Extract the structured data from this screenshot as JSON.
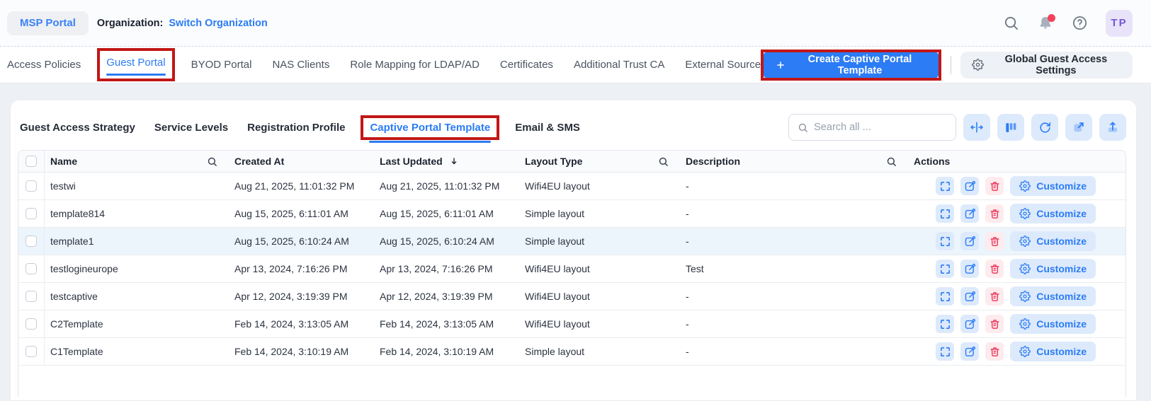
{
  "header": {
    "msp_portal_label": "MSP Portal",
    "organization_label": "Organization:",
    "organization_name": "Switch Organization",
    "avatar_initials": "TP"
  },
  "tabs": {
    "items": [
      "Access Policies",
      "Guest Portal",
      "BYOD Portal",
      "NAS Clients",
      "Role Mapping for LDAP/AD",
      "Certificates",
      "Additional Trust CA",
      "External Source"
    ],
    "active": "Guest Portal"
  },
  "top_actions": {
    "create_button": "Create Captive Portal Template",
    "global_settings_button": "Global Guest Access Settings"
  },
  "subtabs": {
    "items": [
      "Guest Access Strategy",
      "Service Levels",
      "Registration Profile",
      "Captive Portal Template",
      "Email & SMS"
    ],
    "active": "Captive Portal Template"
  },
  "toolbar": {
    "search_placeholder": "Search all ...",
    "icon_buttons": [
      "column-resize-icon",
      "table-columns-icon",
      "refresh-icon",
      "export-icon",
      "upload-icon"
    ]
  },
  "table": {
    "columns": {
      "name": "Name",
      "created_at": "Created At",
      "last_updated": "Last Updated",
      "layout_type": "Layout Type",
      "description": "Description",
      "actions": "Actions"
    },
    "sort": {
      "column": "Last Updated",
      "direction": "desc"
    },
    "customize_label": "Customize",
    "rows": [
      {
        "name": "testwi",
        "created_at": "Aug 21, 2025, 11:01:32 PM",
        "last_updated": "Aug 21, 2025, 11:01:32 PM",
        "layout_type": "Wifi4EU layout",
        "description": "-",
        "highlighted": false
      },
      {
        "name": "template814",
        "created_at": "Aug 15, 2025, 6:11:01 AM",
        "last_updated": "Aug 15, 2025, 6:11:01 AM",
        "layout_type": "Simple layout",
        "description": "-",
        "highlighted": false
      },
      {
        "name": "template1",
        "created_at": "Aug 15, 2025, 6:10:24 AM",
        "last_updated": "Aug 15, 2025, 6:10:24 AM",
        "layout_type": "Simple layout",
        "description": "-",
        "highlighted": true
      },
      {
        "name": "testlogineurope",
        "created_at": "Apr 13, 2024, 7:16:26 PM",
        "last_updated": "Apr 13, 2024, 7:16:26 PM",
        "layout_type": "Wifi4EU layout",
        "description": "Test",
        "highlighted": false
      },
      {
        "name": "testcaptive",
        "created_at": "Apr 12, 2024, 3:19:39 PM",
        "last_updated": "Apr 12, 2024, 3:19:39 PM",
        "layout_type": "Wifi4EU layout",
        "description": "-",
        "highlighted": false
      },
      {
        "name": "C2Template",
        "created_at": "Feb 14, 2024, 3:13:05 AM",
        "last_updated": "Feb 14, 2024, 3:13:05 AM",
        "layout_type": "Wifi4EU layout",
        "description": "-",
        "highlighted": false
      },
      {
        "name": "C1Template",
        "created_at": "Feb 14, 2024, 3:10:19 AM",
        "last_updated": "Feb 14, 2024, 3:10:19 AM",
        "layout_type": "Simple layout",
        "description": "-",
        "highlighted": false
      }
    ]
  },
  "colors": {
    "accent_blue": "#2b7cf5",
    "chip_blue_bg": "#ddeafc",
    "danger_red": "#ee3056",
    "danger_bg": "#fdebee",
    "annotation_red": "#c11717",
    "highlight_row_bg": "#ecf4fc",
    "avatar_bg": "#e9e3fa",
    "avatar_text": "#7258d8",
    "notification_dot": "#f4415a"
  }
}
